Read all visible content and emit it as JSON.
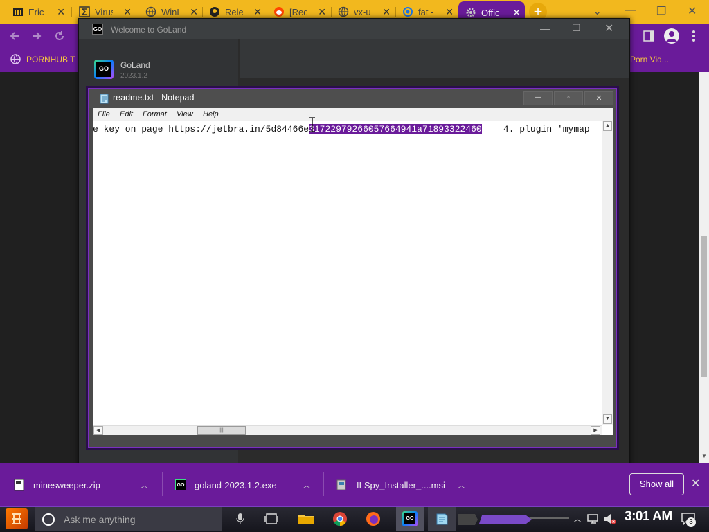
{
  "browser": {
    "tabs": [
      {
        "label": "Eric"
      },
      {
        "label": "Virus"
      },
      {
        "label": "WinL"
      },
      {
        "label": "Relea"
      },
      {
        "label": "[Requ"
      },
      {
        "label": "vx-u"
      },
      {
        "label": "fat -"
      },
      {
        "label": "Offic"
      }
    ],
    "new_tab": "+",
    "bookmarks": {
      "left": "PORNHUB T",
      "right": "Porn Vid..."
    },
    "colors": {
      "tabstrip": "#f2b81e",
      "toolbar": "#6a1b9a"
    }
  },
  "goland": {
    "title": "Welcome to GoLand",
    "product": "GoLand",
    "version": "2023.1.2",
    "logo_text": "GO"
  },
  "notepad": {
    "title": "readme.txt - Notepad",
    "menu": [
      "File",
      "Edit",
      "Format",
      "View",
      "Help"
    ],
    "line_before": "e key on page https://jetbra.in/5d84466e",
    "line_selected": "31722979266057664941a71893322460",
    "line_after": "    4. plugin 'mymap"
  },
  "downloads": {
    "items": [
      {
        "name": "minesweeper.zip"
      },
      {
        "name": "goland-2023.1.2.exe"
      },
      {
        "name": "ILSpy_Installer_....msi"
      }
    ],
    "show_all": "Show all"
  },
  "taskbar": {
    "search_placeholder": "Ask me anything",
    "clock": "3:01 AM",
    "notification_count": "3"
  }
}
